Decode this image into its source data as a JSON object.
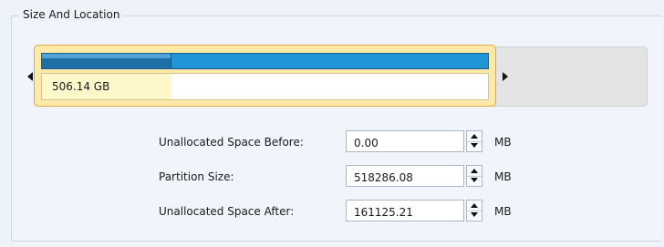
{
  "group": {
    "title": "Size And Location"
  },
  "partition": {
    "size_label": "506.14 GB",
    "used_fraction": 0.29
  },
  "fields": [
    {
      "label": "Unallocated Space Before:",
      "value": "0.00",
      "unit": "MB"
    },
    {
      "label": "Partition Size:",
      "value": "518286.08",
      "unit": "MB"
    },
    {
      "label": "Unallocated Space After:",
      "value": "161125.21",
      "unit": "MB"
    }
  ],
  "colors": {
    "partition_fill": "#fde9a8",
    "partition_border": "#e1a93a",
    "usage_bar": "#2196d6",
    "usage_used": "#1e6fa6"
  }
}
